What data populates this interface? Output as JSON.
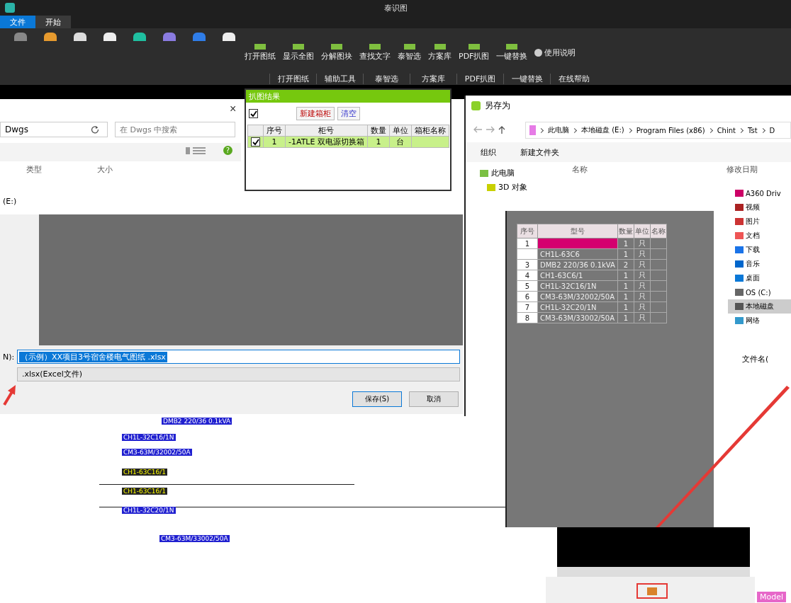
{
  "window": {
    "title": "泰识图"
  },
  "tabs": [
    {
      "label": "文件",
      "selected": true
    },
    {
      "label": "开始",
      "selected": false
    }
  ],
  "ribbon": {
    "buttons": [
      "打开图纸",
      "显示全图",
      "分解图块",
      "查找文字",
      "泰智选",
      "方案库",
      "PDF扒图",
      "一键替换"
    ],
    "help": "使用说明",
    "groups": [
      "打开图纸",
      "辅助工具",
      "泰智选",
      "方案库",
      "PDF扒图",
      "一键替换",
      "在线帮助"
    ]
  },
  "result_panel": {
    "title": "扒图结果",
    "select_all": true,
    "buttons": [
      "新建箱柜",
      "清空"
    ],
    "columns": [
      "序号",
      "柜号",
      "数量",
      "单位",
      "箱柜名称"
    ],
    "rows": [
      {
        "checked": true,
        "cells": [
          "1",
          "-1ATLE 双电源切换箱",
          "1",
          "台",
          ""
        ]
      }
    ]
  },
  "open_dialog": {
    "close": "×",
    "help": "?",
    "address": "Dwgs",
    "search": {
      "placeholder": "在 Dwgs 中搜索"
    },
    "columns": [
      "类型",
      "大小"
    ],
    "nav_item": "(E:)",
    "filename_label": "N):",
    "filename": "（示例）XX项目3号宿舍楼电气图纸 .xlsx",
    "filetype": ".xlsx(Excel文件)",
    "buttons": [
      "保存(S)",
      "取消"
    ]
  },
  "saveas_dialog": {
    "title": "另存为",
    "breadcrumb": [
      "此电脑",
      "本地磁盘 (E:)",
      "Program Files (x86)",
      "Chint",
      "Tst",
      "D"
    ],
    "toolbar": [
      "组织",
      "新建文件夹"
    ],
    "nav_top": [
      "此电脑",
      "3D 对象"
    ],
    "columns": [
      "名称",
      "修改日期"
    ],
    "nav": [
      {
        "label": "A360 Driv",
        "selected": false
      },
      {
        "label": "视频",
        "selected": false
      },
      {
        "label": "图片",
        "selected": false
      },
      {
        "label": "文档",
        "selected": false
      },
      {
        "label": "下载",
        "selected": false
      },
      {
        "label": "音乐",
        "selected": false
      },
      {
        "label": "桌面",
        "selected": false
      },
      {
        "label": "OS (C:)",
        "selected": false
      },
      {
        "label": "本地磁盘",
        "selected": true
      },
      {
        "label": "网络",
        "selected": false
      }
    ],
    "filename_label": "文件名("
  },
  "model_grid": {
    "columns": [
      "序号",
      "型号",
      "数量",
      "单位",
      "名称"
    ],
    "rows": [
      {
        "selected": true,
        "cells": [
          "1",
          "",
          "1",
          "只",
          ""
        ]
      },
      {
        "selected": false,
        "cells": [
          "",
          "CH1L-63C6",
          "1",
          "只",
          ""
        ]
      },
      {
        "selected": false,
        "cells": [
          "3",
          "DMB2 220/36 0.1kVA",
          "2",
          "只",
          ""
        ]
      },
      {
        "selected": false,
        "cells": [
          "4",
          "CH1-63C6/1",
          "1",
          "只",
          ""
        ]
      },
      {
        "selected": false,
        "cells": [
          "5",
          "CH1L-32C16/1N",
          "1",
          "只",
          ""
        ]
      },
      {
        "selected": false,
        "cells": [
          "6",
          "CM3-63M/32002/50A",
          "1",
          "只",
          ""
        ]
      },
      {
        "selected": false,
        "cells": [
          "7",
          "CH1L-32C20/1N",
          "1",
          "只",
          ""
        ]
      },
      {
        "selected": false,
        "cells": [
          "8",
          "CM3-63M/33002/50A",
          "1",
          "只",
          ""
        ]
      }
    ]
  },
  "drawing": {
    "labels": [
      {
        "text": "DMB2 220/36 0.1kVA",
        "kind": "blue"
      },
      {
        "text": "CH1L-32C16/1N",
        "kind": "blue"
      },
      {
        "text": "CM3-63M/32002/50A",
        "kind": "blue"
      },
      {
        "text": "CH1-63C16/1",
        "kind": "olive"
      },
      {
        "text": "CH1-63C16/1",
        "kind": "olive"
      },
      {
        "text": "CH1L-32C20/1N",
        "kind": "blue"
      },
      {
        "text": "CM3-63M/33002/50A",
        "kind": "blue"
      }
    ]
  },
  "status_bar": {
    "layout_tab": "Model"
  }
}
